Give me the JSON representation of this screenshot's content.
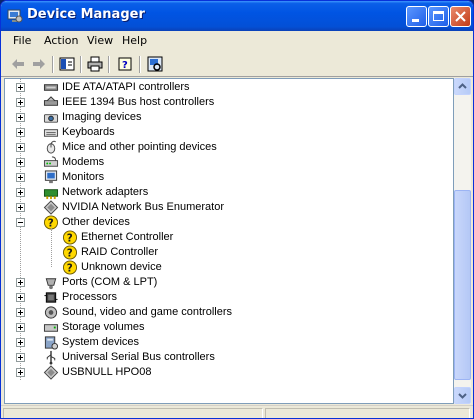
{
  "window": {
    "title": "Device Manager"
  },
  "menu": [
    "File",
    "Action",
    "View",
    "Help"
  ],
  "toolbar": {
    "buttons": [
      "back-arrow-icon",
      "forward-arrow-icon",
      "properties-icon",
      "print-icon",
      "help-icon",
      "scan-hardware-icon"
    ]
  },
  "tree": [
    {
      "label": "IDE ATA/ATAPI controllers",
      "icon": "ide-controller-icon",
      "expanded": false
    },
    {
      "label": "IEEE 1394 Bus host controllers",
      "icon": "ieee1394-icon",
      "expanded": false
    },
    {
      "label": "Imaging devices",
      "icon": "imaging-device-icon",
      "expanded": false
    },
    {
      "label": "Keyboards",
      "icon": "keyboard-icon",
      "expanded": false
    },
    {
      "label": "Mice and other pointing devices",
      "icon": "mouse-icon",
      "expanded": false
    },
    {
      "label": "Modems",
      "icon": "modem-icon",
      "expanded": false
    },
    {
      "label": "Monitors",
      "icon": "monitor-icon",
      "expanded": false
    },
    {
      "label": "Network adapters",
      "icon": "network-adapter-icon",
      "expanded": false
    },
    {
      "label": "NVIDIA Network Bus Enumerator",
      "icon": "bus-enumerator-icon",
      "expanded": false
    },
    {
      "label": "Other devices",
      "icon": "unknown-device-icon",
      "expanded": true,
      "children": [
        "Ethernet Controller",
        "RAID Controller",
        "Unknown device"
      ]
    },
    {
      "label": "Ports (COM & LPT)",
      "icon": "port-icon",
      "expanded": false
    },
    {
      "label": "Processors",
      "icon": "processor-icon",
      "expanded": false
    },
    {
      "label": "Sound, video and game controllers",
      "icon": "sound-icon",
      "expanded": false
    },
    {
      "label": "Storage volumes",
      "icon": "storage-volume-icon",
      "expanded": false
    },
    {
      "label": "System devices",
      "icon": "system-device-icon",
      "expanded": false
    },
    {
      "label": "Universal Serial Bus controllers",
      "icon": "usb-icon",
      "expanded": false
    },
    {
      "label": "USBNULL HPO08",
      "icon": "bus-enumerator-icon",
      "expanded": false
    }
  ],
  "colors": {
    "titlebar": "#0054e3",
    "window_bg": "#ece9d8",
    "warning": "#ffd800"
  }
}
